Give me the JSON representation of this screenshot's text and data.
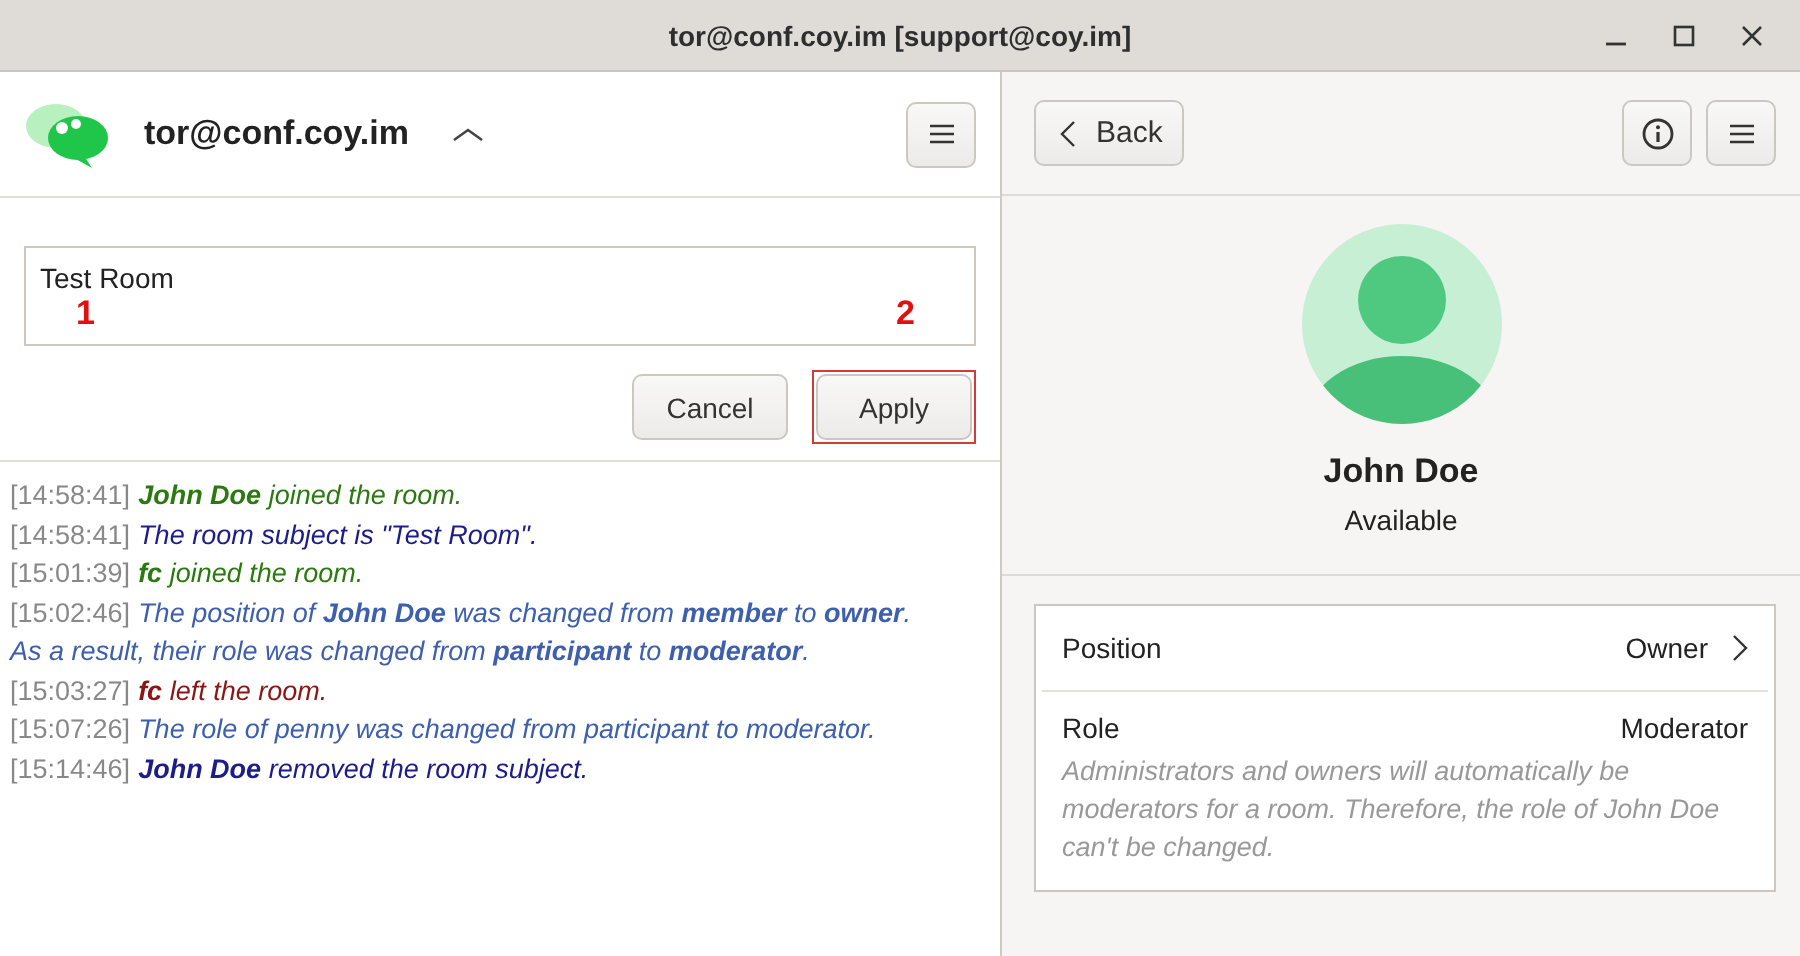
{
  "window": {
    "title": "tor@conf.coy.im [support@coy.im]"
  },
  "room": {
    "name": "tor@conf.coy.im",
    "subject_field": {
      "value": "Test Room"
    },
    "buttons": [
      {
        "label": "Cancel",
        "highlighted": false
      },
      {
        "label": "Apply",
        "highlighted": true
      }
    ]
  },
  "annotations": [
    "1",
    "2"
  ],
  "log": [
    {
      "time": "[14:58:41]",
      "message": "**John Doe** joined the room.",
      "color": "#2a7a10"
    },
    {
      "time": "[14:58:41]",
      "message": "The room subject is \"Test Room\".",
      "color": "#1c1c8a"
    },
    {
      "time": "[15:01:39]",
      "message": "**fc** joined the room.",
      "color": "#2a7a10"
    },
    {
      "time": "[15:02:46]",
      "message": "The position of **John Doe** was changed from **member** to **owner**.",
      "message_continued": "As a result, their role was changed from **participant** to **moderator**.",
      "color": "#3d5fae"
    },
    {
      "time": "[15:03:27]",
      "message": "**fc** left the room.",
      "color": "#8a1616"
    },
    {
      "time": "[15:07:26]",
      "message": "The role of penny was changed from participant to moderator.",
      "color": "#3d5fae"
    },
    {
      "time": "[15:14:46]",
      "message": "**John Doe** removed the room subject.",
      "color": "#1c1c8a"
    }
  ],
  "occupant": {
    "back": "Back",
    "name": "John Doe",
    "status": "Available",
    "rows": [
      {
        "label": "Position",
        "value": "Owner",
        "kind": "link"
      },
      {
        "label": "Role",
        "value": "Moderator",
        "kind": "info",
        "note": "Administrators and owners will automatically be moderators for a room. Therefore, the role of John Doe can't be changed."
      }
    ]
  }
}
